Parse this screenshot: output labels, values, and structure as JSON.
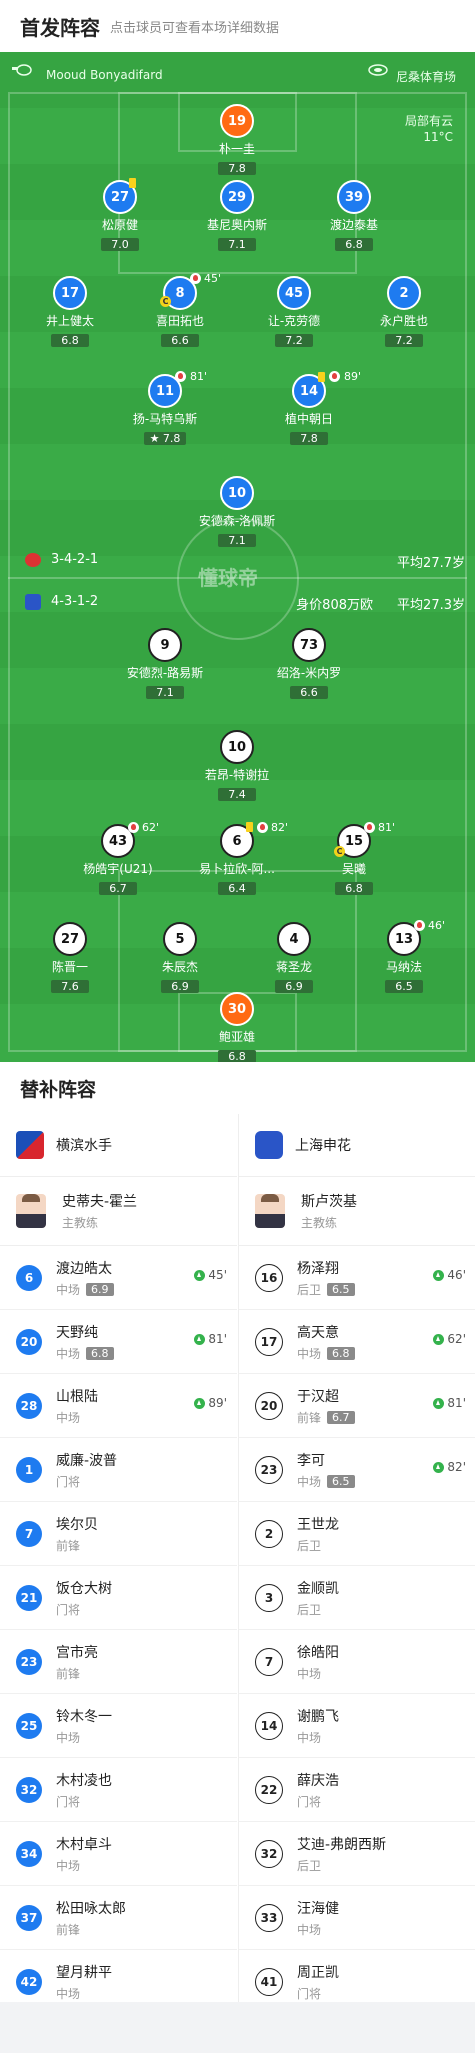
{
  "header": {
    "title": "首发阵容",
    "hint": "点击球员可查看本场详细数据"
  },
  "pitch": {
    "referee": "Mooud Bonyadifard",
    "stadium": "尼桑体育场",
    "weather": "局部有云",
    "temperature": "11°C",
    "watermark": "懂球帝",
    "home": {
      "formation": "3-4-2-1",
      "avg_age": "平均27.7岁"
    },
    "away": {
      "formation": "4-3-1-2",
      "value": "身价808万欧",
      "avg_age": "平均27.3岁"
    }
  },
  "home_players": [
    {
      "num": "19",
      "name": "朴一圭",
      "rating": "7.8"
    },
    {
      "num": "27",
      "name": "松原健",
      "rating": "7.0"
    },
    {
      "num": "29",
      "name": "基尼奥内斯",
      "rating": "7.1"
    },
    {
      "num": "39",
      "name": "渡边泰基",
      "rating": "6.8"
    },
    {
      "num": "17",
      "name": "井上健太",
      "rating": "6.8"
    },
    {
      "num": "8",
      "name": "喜田拓也",
      "rating": "6.6",
      "event": "45'"
    },
    {
      "num": "45",
      "name": "让-克劳德",
      "rating": "7.2"
    },
    {
      "num": "2",
      "name": "永户胜也",
      "rating": "7.2"
    },
    {
      "num": "11",
      "name": "扬-马特乌斯",
      "rating": "7.8",
      "event": "81'"
    },
    {
      "num": "14",
      "name": "植中朝日",
      "rating": "7.8",
      "event": "89'"
    },
    {
      "num": "10",
      "name": "安德森-洛佩斯",
      "rating": "7.1"
    }
  ],
  "away_players": [
    {
      "num": "9",
      "name": "安德烈-路易斯",
      "rating": "7.1"
    },
    {
      "num": "73",
      "name": "绍洛-米内罗",
      "rating": "6.6"
    },
    {
      "num": "10",
      "name": "若昂-特谢拉",
      "rating": "7.4"
    },
    {
      "num": "43",
      "name": "杨皓宇(U21)",
      "rating": "6.7",
      "event": "62'"
    },
    {
      "num": "6",
      "name": "易卜拉欣-阿...",
      "rating": "6.4",
      "event": "82'"
    },
    {
      "num": "15",
      "name": "吴曦",
      "rating": "6.8",
      "event": "81'"
    },
    {
      "num": "27",
      "name": "陈晋一",
      "rating": "7.6"
    },
    {
      "num": "5",
      "name": "朱辰杰",
      "rating": "6.9"
    },
    {
      "num": "4",
      "name": "蒋圣龙",
      "rating": "6.9"
    },
    {
      "num": "13",
      "name": "马纳法",
      "rating": "6.5",
      "event": "46'"
    },
    {
      "num": "30",
      "name": "鲍亚雄",
      "rating": "6.8"
    }
  ],
  "subs_title": "替补阵容",
  "home_team": {
    "name": "横滨水手",
    "coach": {
      "name": "史蒂夫-霍兰",
      "role": "主教练"
    },
    "subs": [
      {
        "num": "6",
        "name": "渡边皓太",
        "pos": "中场",
        "rating": "6.9",
        "in": "45'"
      },
      {
        "num": "20",
        "name": "天野纯",
        "pos": "中场",
        "rating": "6.8",
        "in": "81'"
      },
      {
        "num": "28",
        "name": "山根陆",
        "pos": "中场",
        "rating": "",
        "in": "89'"
      },
      {
        "num": "1",
        "name": "威廉-波普",
        "pos": "门将",
        "rating": "",
        "in": ""
      },
      {
        "num": "7",
        "name": "埃尔贝",
        "pos": "前锋",
        "rating": "",
        "in": ""
      },
      {
        "num": "21",
        "name": "饭仓大树",
        "pos": "门将",
        "rating": "",
        "in": ""
      },
      {
        "num": "23",
        "name": "宫市亮",
        "pos": "前锋",
        "rating": "",
        "in": ""
      },
      {
        "num": "25",
        "name": "铃木冬一",
        "pos": "中场",
        "rating": "",
        "in": ""
      },
      {
        "num": "32",
        "name": "木村凌也",
        "pos": "门将",
        "rating": "",
        "in": ""
      },
      {
        "num": "34",
        "name": "木村卓斗",
        "pos": "中场",
        "rating": "",
        "in": ""
      },
      {
        "num": "37",
        "name": "松田咏太郎",
        "pos": "前锋",
        "rating": "",
        "in": ""
      },
      {
        "num": "42",
        "name": "望月耕平",
        "pos": "中场",
        "rating": "",
        "in": ""
      }
    ]
  },
  "away_team": {
    "name": "上海申花",
    "coach": {
      "name": "斯卢茨基",
      "role": "主教练"
    },
    "subs": [
      {
        "num": "16",
        "name": "杨泽翔",
        "pos": "后卫",
        "rating": "6.5",
        "in": "46'"
      },
      {
        "num": "17",
        "name": "高天意",
        "pos": "中场",
        "rating": "6.8",
        "in": "62'"
      },
      {
        "num": "20",
        "name": "于汉超",
        "pos": "前锋",
        "rating": "6.7",
        "in": "81'"
      },
      {
        "num": "23",
        "name": "李可",
        "pos": "中场",
        "rating": "6.5",
        "in": "82'"
      },
      {
        "num": "2",
        "name": "王世龙",
        "pos": "后卫",
        "rating": "",
        "in": ""
      },
      {
        "num": "3",
        "name": "金顺凯",
        "pos": "后卫",
        "rating": "",
        "in": ""
      },
      {
        "num": "7",
        "name": "徐皓阳",
        "pos": "中场",
        "rating": "",
        "in": ""
      },
      {
        "num": "14",
        "name": "谢鹏飞",
        "pos": "中场",
        "rating": "",
        "in": ""
      },
      {
        "num": "22",
        "name": "薛庆浩",
        "pos": "门将",
        "rating": "",
        "in": ""
      },
      {
        "num": "32",
        "name": "艾迪-弗朗西斯",
        "pos": "后卫",
        "rating": "",
        "in": ""
      },
      {
        "num": "33",
        "name": "汪海健",
        "pos": "中场",
        "rating": "",
        "in": ""
      },
      {
        "num": "41",
        "name": "周正凯",
        "pos": "门将",
        "rating": "",
        "in": ""
      }
    ]
  }
}
